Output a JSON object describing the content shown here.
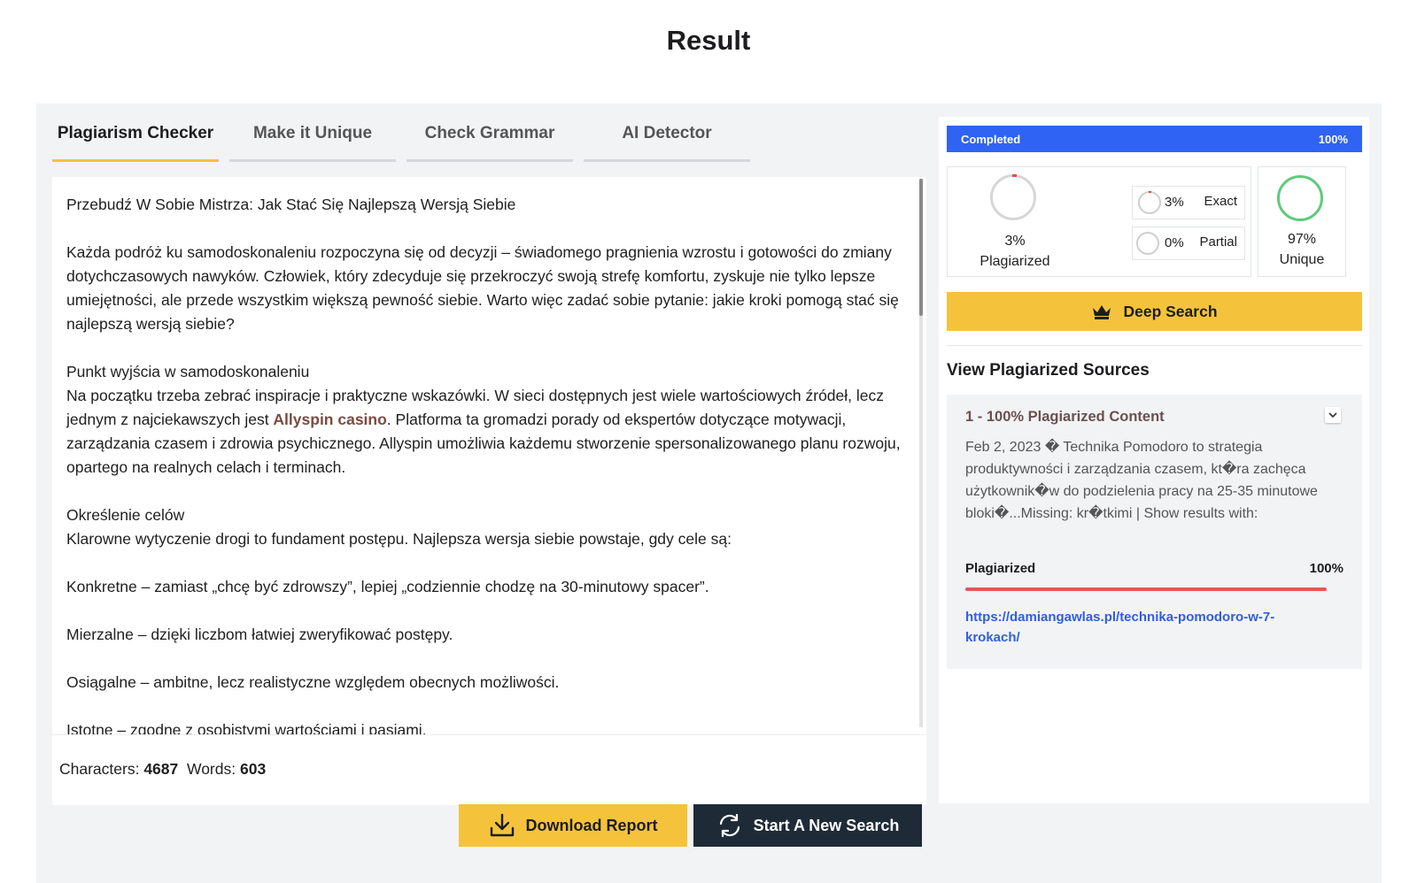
{
  "page": {
    "title": "Result"
  },
  "tabs": [
    {
      "label": "Plagiarism Checker",
      "active": true
    },
    {
      "label": "Make it Unique",
      "active": false
    },
    {
      "label": "Check Grammar",
      "active": false
    },
    {
      "label": "AI Detector",
      "active": false
    }
  ],
  "document": {
    "title_line": "Przebudź W Sobie Mistrza: Jak Stać Się Najlepszą Wersją Siebie",
    "para1": "Każda podróż ku samodoskonaleniu rozpoczyna się od decyzji – świadomego pragnienia wzrostu i gotowości do zmiany dotychczasowych nawyków. Człowiek, który zdecyduje się przekroczyć swoją strefę komfortu, zyskuje nie tylko lepsze umiejętności, ale przede wszystkim większą pewność siebie. Warto więc zadać sobie pytanie: jakie kroki pomogą stać się najlepszą wersją siebie?",
    "heading1": "Punkt wyjścia w samodoskonaleniu",
    "para2_before": "Na początku trzeba zebrać inspiracje i praktyczne wskazówki. W sieci dostępnych jest wiele wartościowych źródeł, lecz jednym z najciekawszych jest ",
    "para2_link": "Allyspin casino",
    "para2_after": ". Platforma ta gromadzi porady od ekspertów dotyczące motywacji, zarządzania czasem i zdrowia psychicznego. Allyspin umożliwia każdemu stworzenie spersonalizowanego planu rozwoju, opartego na realnych celach i terminach.",
    "heading2": "Określenie celów",
    "para3": "Klarowne wytyczenie drogi to fundament postępu. Najlepsza wersja siebie powstaje, gdy cele są:",
    "item1": "Konkretne – zamiast „chcę być zdrowszy”, lepiej „codziennie chodzę na 30-minutowy spacer”.",
    "item2": "Mierzalne – dzięki liczbom łatwiej zweryfikować postępy.",
    "item3": "Osiągalne – ambitne, lecz realistyczne względem obecnych możliwości.",
    "item4": "Istotne – zgodne z osobistymi wartościami i pasjami."
  },
  "stats": {
    "characters_label": "Characters:",
    "characters": "4687",
    "words_label": "Words:",
    "words": "603"
  },
  "progress": {
    "label": "Completed",
    "value": "100%"
  },
  "result": {
    "plagiarized_pct": "3%",
    "plagiarized_label": "Plagiarized",
    "exact_pct": "3%",
    "exact_label": "Exact",
    "partial_pct": "0%",
    "partial_label": "Partial",
    "unique_pct": "97%",
    "unique_label": "Unique"
  },
  "deep_search": {
    "label": "Deep Search",
    "icon": "crown-icon"
  },
  "sources": {
    "title": "View Plagiarized Sources",
    "items": [
      {
        "heading": "1 - 100% Plagiarized Content",
        "snippet": "Feb 2, 2023 � Technika Pomodoro to strategia produktywności i zarządzania czasem, kt�ra zachęca użytkownik�w do podzielenia pracy na 25-35 minutowe bloki�...Missing: kr�tkimi | Show results with:",
        "meter_label": "Plagiarized",
        "meter_value": "100%",
        "meter_fraction": 1.0,
        "url": "https://damiangawlas.pl/technika-pomodoro-w-7-krokach/"
      }
    ]
  },
  "actions": {
    "download_label": "Download Report",
    "new_search_label": "Start A New Search"
  },
  "colors": {
    "accent_yellow": "#f5c33b",
    "progress_blue": "#2f63f3",
    "unique_green": "#5ccb7a",
    "plagiarized_red": "#e05a5a",
    "dark_button": "#1e2b37"
  }
}
